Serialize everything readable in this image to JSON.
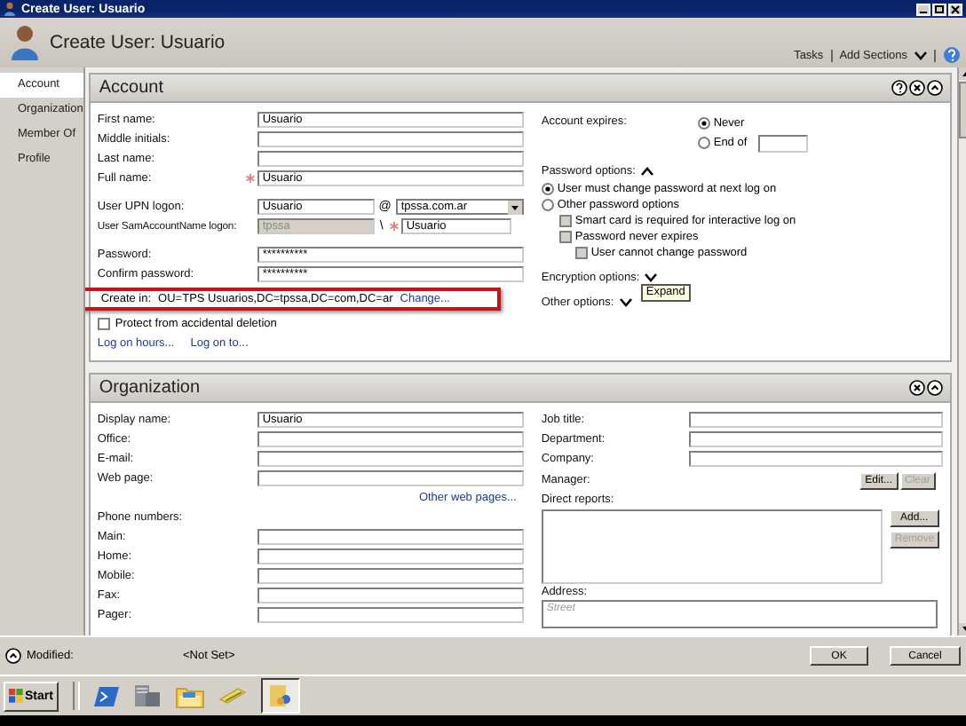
{
  "window": {
    "title": "Create User: Usuario"
  },
  "header": {
    "title": "Create User: Usuario",
    "links": [
      "Tasks",
      "Add Sections"
    ]
  },
  "sidebar": {
    "items": [
      {
        "label": "Account",
        "selected": true
      },
      {
        "label": "Organization",
        "selected": false
      },
      {
        "label": "Member Of",
        "selected": false
      },
      {
        "label": "Profile",
        "selected": false
      }
    ]
  },
  "account": {
    "title": "Account",
    "fields": [
      {
        "label": "First name:",
        "value": "Usuario",
        "required": false
      },
      {
        "label": "Middle initials:",
        "required": false
      },
      {
        "label": "Last name:",
        "required": false
      },
      {
        "label": "Full name:",
        "value": "Usuario",
        "required": true
      }
    ],
    "upn": {
      "label": "User UPN logon:",
      "value": "Usuario",
      "at": "@",
      "domain": "tpssa.com.ar"
    },
    "sam": {
      "label": "User SamAccountName logon:",
      "domain": "tpssa",
      "separator": "\\",
      "value": "Usuario",
      "required": true
    },
    "passwords": [
      {
        "label": "Password:",
        "value": "**********"
      },
      {
        "label": "Confirm password:",
        "value": "**********"
      }
    ],
    "create_in": {
      "label": "Create in:",
      "value": "OU=TPS Usuarios,DC=tpssa,DC=com,DC=ar",
      "link": "Change..."
    },
    "protect": {
      "label": "Protect from accidental deletion",
      "checked": false
    },
    "links": [
      "Log on hours...",
      "Log on to..."
    ],
    "expires": {
      "label": "Account expires:",
      "options": [
        {
          "label": "Never",
          "selected": true
        },
        {
          "label": "End of",
          "selected": false
        }
      ]
    },
    "password_options": {
      "label": "Password options:",
      "expanded": true,
      "options": [
        {
          "label": "User must change password at next log on",
          "selected": true
        },
        {
          "label": "Other password options",
          "selected": false
        }
      ],
      "checkboxes": [
        {
          "label": "Smart card is required for interactive log on",
          "checked": false,
          "disabled": true
        },
        {
          "label": "Password never expires",
          "checked": false,
          "disabled": true,
          "children": [
            {
              "label": "User cannot change password",
              "checked": false,
              "disabled": true
            }
          ]
        }
      ]
    },
    "encryption": {
      "label": "Encryption options:",
      "expanded": false
    },
    "other": {
      "label": "Other options:",
      "expanded": false
    },
    "tooltip": "Expand"
  },
  "organization": {
    "title": "Organization",
    "fields": [
      {
        "label": "Display name:",
        "value": "Usuario"
      },
      {
        "label": "Office:"
      },
      {
        "label": "E-mail:"
      },
      {
        "label": "Web page:"
      }
    ],
    "link": "Other web pages...",
    "phone_label": "Phone numbers:",
    "phones": [
      {
        "label": "Main:"
      },
      {
        "label": "Home:"
      },
      {
        "label": "Mobile:"
      },
      {
        "label": "Fax:"
      },
      {
        "label": "Pager:"
      }
    ],
    "job_fields": [
      {
        "label": "Job title:"
      },
      {
        "label": "Department:"
      },
      {
        "label": "Company:"
      }
    ],
    "manager": {
      "label": "Manager:",
      "buttons": [
        {
          "label": "Edit...",
          "disabled": false
        },
        {
          "label": "Clear",
          "disabled": true
        }
      ]
    },
    "direct_reports": {
      "label": "Direct reports:",
      "buttons": [
        {
          "label": "Add...",
          "disabled": false
        },
        {
          "label": "Remove",
          "disabled": true
        }
      ]
    },
    "address": {
      "label": "Address:",
      "placeholder": "Street"
    }
  },
  "status": {
    "label": "Modified:",
    "value": "<Not Set>"
  },
  "buttons": [
    "OK",
    "Cancel"
  ],
  "taskbar": {
    "start": "Start"
  }
}
